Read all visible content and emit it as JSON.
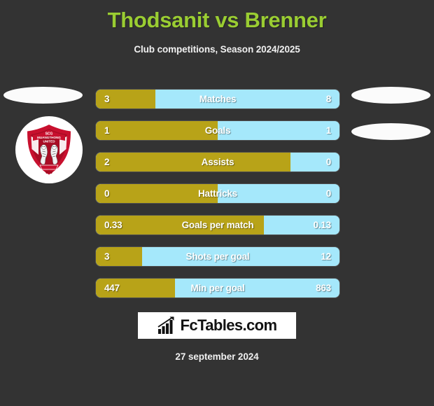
{
  "header": {
    "title": "Thodsanit vs Brenner",
    "subtitle": "Club competitions, Season 2024/2025"
  },
  "colors": {
    "background": "#333333",
    "title": "#9acd32",
    "home_bar": "#b8a318",
    "away_bar": "#a5e8fb",
    "text": "#ffffff",
    "badge_primary": "#c8102e",
    "badge_dark": "#8f0a20"
  },
  "badge": {
    "name": "scg-muangthong-united-badge",
    "club": "SCG MUANGTHONG UNITED",
    "line1": "SCG",
    "line2": "MUANGTHONG",
    "line3": "UNITED"
  },
  "side_images": [
    {
      "name": "player-photo-left-top"
    },
    {
      "name": "player-photo-right-top"
    },
    {
      "name": "player-photo-right-mid"
    }
  ],
  "stats": [
    {
      "label": "Matches",
      "home": "3",
      "away": "8",
      "home_pct": 24.4
    },
    {
      "label": "Goals",
      "home": "1",
      "away": "1",
      "home_pct": 50.0
    },
    {
      "label": "Assists",
      "home": "2",
      "away": "0",
      "home_pct": 80.0
    },
    {
      "label": "Hattricks",
      "home": "0",
      "away": "0",
      "home_pct": 50.0
    },
    {
      "label": "Goals per match",
      "home": "0.33",
      "away": "0.13",
      "home_pct": 69.0
    },
    {
      "label": "Shots per goal",
      "home": "3",
      "away": "12",
      "home_pct": 19.0
    },
    {
      "label": "Min per goal",
      "home": "447",
      "away": "863",
      "home_pct": 32.5
    }
  ],
  "footer": {
    "logo_text": "FcTables.com",
    "logo_icon": "bar-chart-growth-icon",
    "date": "27 september 2024"
  }
}
